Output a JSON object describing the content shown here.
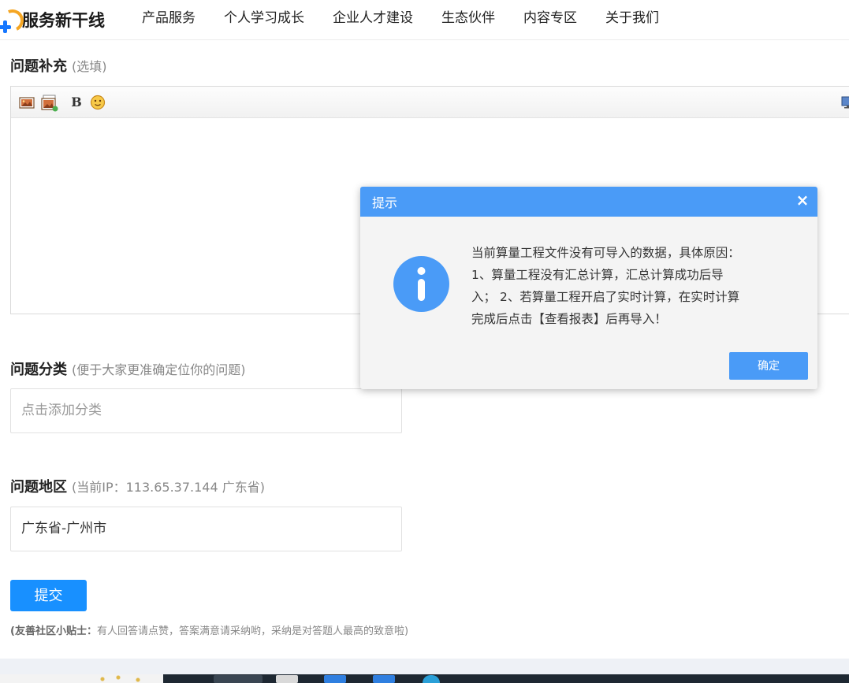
{
  "header": {
    "logo_text": "服务新干线",
    "nav": [
      "产品服务",
      "个人学习成长",
      "企业人才建设",
      "生态伙伴",
      "内容专区",
      "关于我们"
    ]
  },
  "form": {
    "supplement": {
      "title": "问题补充",
      "hint": "(选填)"
    },
    "category": {
      "title": "问题分类",
      "hint": "(便于大家更准确定位你的问题)",
      "placeholder": "点击添加分类"
    },
    "region": {
      "title": "问题地区",
      "hint": "(当前IP：113.65.37.144 广东省)",
      "value": "广东省-广州市"
    },
    "submit_label": "提交",
    "tip_label": "(友善社区小贴士：",
    "tip_text": "有人回答请点赞，答案满意请采纳哟，采纳是对答题人最高的致意啦)"
  },
  "editor_toolbar": {
    "bold_label": "B",
    "icons": [
      "image-icon",
      "image-upload-icon",
      "bold-icon",
      "emoji-icon",
      "fullscreen-icon"
    ]
  },
  "dialog": {
    "title": "提示",
    "close_glyph": "×",
    "message_lines": [
      "当前算量工程文件没有可导入的数据，具体原因：",
      "1、算量工程没有汇总计算，汇总计算成功后导",
      "入； 2、若算量工程开启了实时计算，在实时计算",
      "完成后点击【查看报表】后再导入！"
    ],
    "ok_label": "确定"
  },
  "colors": {
    "primary": "#1890ff",
    "dialog_header": "#4a9bf7",
    "info_icon": "#4a9bf7",
    "logo_orange": "#f5a623",
    "logo_blue": "#1677ff"
  }
}
